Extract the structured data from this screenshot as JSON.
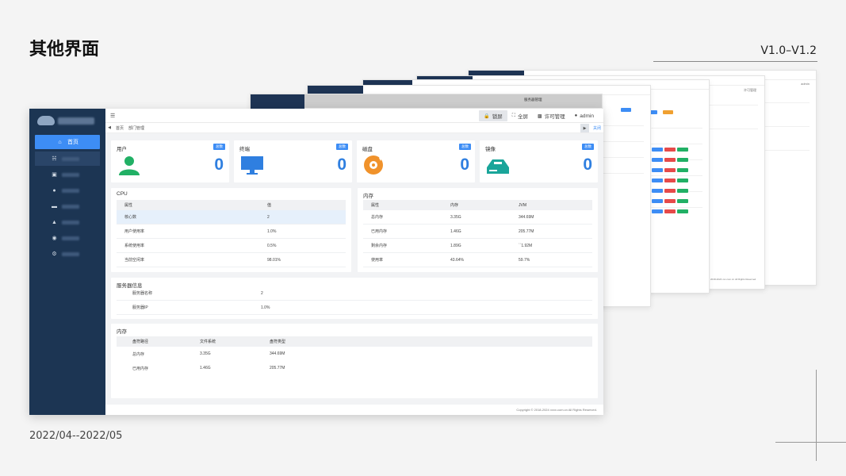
{
  "slide": {
    "title": "其他界面",
    "version": "V1.0–V1.2",
    "date_range": "2022/04--2022/05"
  },
  "colors": {
    "sidebar": "#1c3553",
    "accent": "#3d8df5",
    "value_blue": "#2f7fe0",
    "green": "#21b065",
    "orange": "#f0922b",
    "teal": "#1aa59a"
  },
  "ghosts": {
    "g1_header": "服务器管理",
    "g_buttons": [
      "锁屏",
      "全屏",
      "许可管理",
      "admin"
    ],
    "g_footer": "Copyright © 2018-2024 xxx.com.cn All Rights Reserved."
  },
  "app": {
    "topbar": {
      "menu_icon": "menu-icon",
      "lock": "锁屏",
      "fullscreen": "全屏",
      "license": "许可管理",
      "user": "admin"
    },
    "tabs": {
      "home": "首页",
      "dept": "部门管理",
      "close": "关闭"
    },
    "sidebar": {
      "home": "首页"
    },
    "stats": [
      {
        "title": "用户",
        "badge": "总数",
        "value": "0",
        "icon": "user-icon"
      },
      {
        "title": "终端",
        "badge": "总数",
        "value": "0",
        "icon": "monitor-icon"
      },
      {
        "title": "磁盘",
        "badge": "总数",
        "value": "0",
        "icon": "disk-icon"
      },
      {
        "title": "镜像",
        "badge": "总数",
        "value": "0",
        "icon": "image-drive-icon"
      }
    ],
    "cpu": {
      "title": "CPU",
      "headers": [
        "属性",
        "值"
      ],
      "rows": [
        [
          "核心数",
          "2"
        ],
        [
          "用户使用率",
          "1.0%"
        ],
        [
          "系统使用率",
          "0.5%"
        ],
        [
          "当前空闲率",
          "98.01%"
        ]
      ]
    },
    "memory": {
      "title": "内存",
      "headers": [
        "属性",
        "内存",
        "JVM"
      ],
      "rows": [
        [
          "总内存",
          "3.35G",
          "344.69M"
        ],
        [
          "已用内存",
          "1.46G",
          "205.77M"
        ],
        [
          "剩余内存",
          "1.89G",
          "``1.92M"
        ],
        [
          "使用率",
          "43.64%",
          "59.7%"
        ]
      ]
    },
    "server": {
      "title": "服务器信息",
      "rows": [
        [
          "服务器名称",
          "2"
        ],
        [
          "服务器IP",
          "1.0%"
        ]
      ]
    },
    "disk": {
      "title": "内存",
      "headers": [
        "盘符路径",
        "文件系统",
        "盘符类型"
      ],
      "rows": [
        [
          "总内存",
          "3.35G",
          "344.69M"
        ],
        [
          "已用内存",
          "1.46G",
          "205.77M"
        ]
      ]
    },
    "footer": "Copyright © 2018-2024 xxxx.com.cn All Rights Reserved."
  }
}
